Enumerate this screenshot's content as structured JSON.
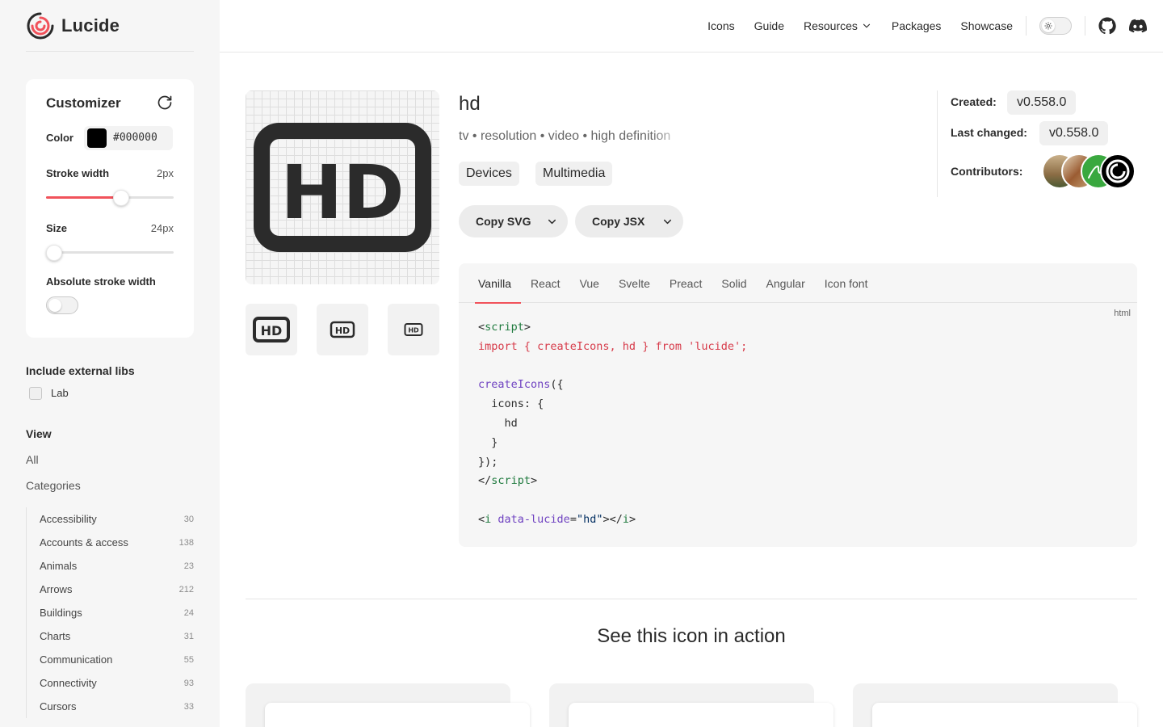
{
  "brand": {
    "name": "Lucide",
    "accent": "#f1525b"
  },
  "customizer": {
    "title": "Customizer",
    "color_label": "Color",
    "color_value": "#000000",
    "stroke_label": "Stroke width",
    "stroke_value": "2px",
    "stroke_fraction": 0.6,
    "size_label": "Size",
    "size_value": "24px",
    "size_fraction": 0.0,
    "absolute_label": "Absolute stroke width",
    "absolute_on": false
  },
  "external_libs": {
    "heading": "Include external libs",
    "lab_label": "Lab"
  },
  "view": {
    "heading": "View",
    "all": "All",
    "categories": "Categories"
  },
  "categories": [
    {
      "name": "Accessibility",
      "count": "30"
    },
    {
      "name": "Accounts & access",
      "count": "138"
    },
    {
      "name": "Animals",
      "count": "23"
    },
    {
      "name": "Arrows",
      "count": "212"
    },
    {
      "name": "Buildings",
      "count": "24"
    },
    {
      "name": "Charts",
      "count": "31"
    },
    {
      "name": "Communication",
      "count": "55"
    },
    {
      "name": "Connectivity",
      "count": "93"
    },
    {
      "name": "Cursors",
      "count": "33"
    }
  ],
  "nav": {
    "icons": "Icons",
    "guide": "Guide",
    "resources": "Resources",
    "packages": "Packages",
    "showcase": "Showcase"
  },
  "icon": {
    "name": "hd",
    "tags": "tv • resolution • video • high definition",
    "categories": [
      "Devices",
      "Multimedia"
    ],
    "preview_glyph": "HD",
    "copy_svg": "Copy SVG",
    "copy_jsx": "Copy JSX"
  },
  "meta": {
    "created_label": "Created:",
    "created_value": "v0.558.0",
    "changed_label": "Last changed:",
    "changed_value": "v0.558.0",
    "contributors_label": "Contributors:"
  },
  "code": {
    "tabs": [
      "Vanilla",
      "React",
      "Vue",
      "Svelte",
      "Preact",
      "Solid",
      "Angular",
      "Icon font"
    ],
    "active_tab": "Vanilla",
    "language": "html",
    "lines": {
      "l1_open": "<",
      "l1_tag": "script",
      "l1_close": ">",
      "l2": "import { createIcons, hd } from 'lucide';",
      "l4_fn": "createIcons",
      "l4_rest": "({",
      "l5": "  icons: {",
      "l6": "    hd",
      "l7": "  }",
      "l8": "});",
      "l9_open": "</",
      "l9_tag": "script",
      "l9_close": ">",
      "l11_open": "<",
      "l11_tag": "i",
      "l11_attr": " data-lucide",
      "l11_eq": "=",
      "l11_str": "\"hd\"",
      "l11_mid": "></",
      "l11_tag2": "i",
      "l11_close": ">"
    }
  },
  "action_section": {
    "title": "See this icon in action"
  }
}
